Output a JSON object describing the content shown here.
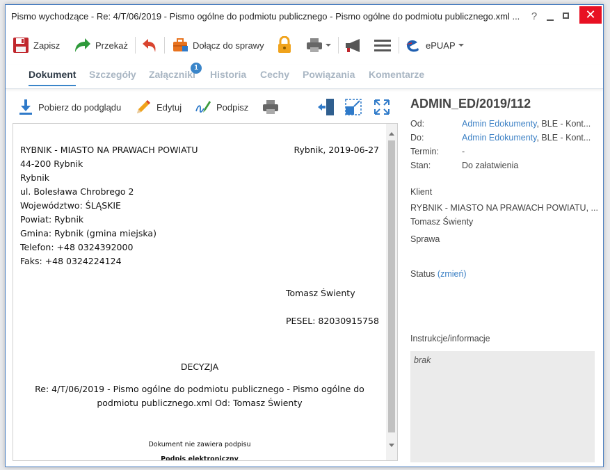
{
  "window": {
    "title": "Pismo wychodzące - Re: 4/T/06/2019 - Pismo ogólne do podmiotu publicznego - Pismo ogólne do podmiotu publicznego.xml ...",
    "help": "?",
    "close": "✕"
  },
  "toolbar": {
    "save": "Zapisz",
    "forward": "Przekaż",
    "attach": "Dołącz do sprawy",
    "epuap": "ePUAP"
  },
  "tabs": [
    "Dokument",
    "Szczegóły",
    "Załączniki",
    "Historia",
    "Cechy",
    "Powiązania",
    "Komentarze"
  ],
  "attachments_badge": "1",
  "doc_actions": {
    "download": "Pobierz do podglądu",
    "edit": "Edytuj",
    "sign": "Podpisz"
  },
  "preview": {
    "sender_lines": [
      "RYBNIK - MIASTO NA PRAWACH POWIATU",
      "44-200 Rybnik",
      "Rybnik",
      "ul. Bolesława Chrobrego 2",
      "Województwo: ŚLĄSKIE",
      "Powiat: Rybnik",
      "Gmina: Rybnik (gmina miejska)",
      "Telefon: +48 0324392000",
      "Faks: +48 0324224124"
    ],
    "place_date": "Rybnik, 2019-06-27",
    "recipient": "Tomasz Świenty",
    "pesel": "PESEL: 82030915758",
    "heading": "DECYZJA",
    "re_line1": "Re: 4/T/06/2019 - Pismo ogólne do podmiotu publicznego - Pismo ogólne do",
    "re_line2": "podmiotu publicznego.xml Od: Tomasz Świenty",
    "no_signature": "Dokument nie zawiera podpisu",
    "cut_text": "Podpis elektroniczny"
  },
  "details": {
    "case_number": "ADMIN_ED/2019/112",
    "from_label": "Od:",
    "from_link": "Admin Edokumenty",
    "from_rest": ", BLE - Kont...",
    "to_label": "Do:",
    "to_link": "Admin Edokumenty",
    "to_rest": ", BLE - Kont...",
    "deadline_label": "Termin:",
    "deadline_value": "-",
    "state_label": "Stan:",
    "state_value": "Do załatwienia",
    "client_label": "Klient",
    "client_org": "RYBNIK - MIASTO NA PRAWACH POWIATU, ...",
    "client_person": "Tomasz Świenty",
    "case_label": "Sprawa",
    "status_label": "Status",
    "status_change": "(zmień)",
    "instructions_label": "Instrukcje/informacje",
    "instructions_value": "brak"
  },
  "colors": {
    "accent": "#3a85c9",
    "link": "#3a7fc4",
    "close": "#e81123",
    "save_icon": "#c0272d",
    "forward_icon": "#2e9a3a",
    "undo_icon": "#d9442f",
    "lock_icon": "#f0a31c",
    "epuap_icon": "#1f5fb0"
  }
}
